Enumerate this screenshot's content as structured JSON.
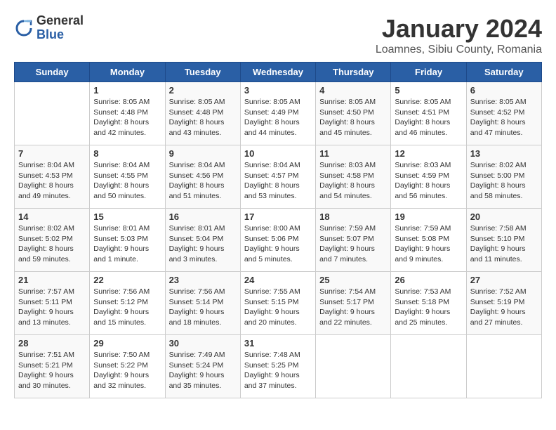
{
  "logo": {
    "general": "General",
    "blue": "Blue"
  },
  "title": "January 2024",
  "subtitle": "Loamnes, Sibiu County, Romania",
  "days": [
    "Sunday",
    "Monday",
    "Tuesday",
    "Wednesday",
    "Thursday",
    "Friday",
    "Saturday"
  ],
  "weeks": [
    [
      {
        "date": "",
        "content": ""
      },
      {
        "date": "1",
        "content": "Sunrise: 8:05 AM\nSunset: 4:48 PM\nDaylight: 8 hours\nand 42 minutes."
      },
      {
        "date": "2",
        "content": "Sunrise: 8:05 AM\nSunset: 4:48 PM\nDaylight: 8 hours\nand 43 minutes."
      },
      {
        "date": "3",
        "content": "Sunrise: 8:05 AM\nSunset: 4:49 PM\nDaylight: 8 hours\nand 44 minutes."
      },
      {
        "date": "4",
        "content": "Sunrise: 8:05 AM\nSunset: 4:50 PM\nDaylight: 8 hours\nand 45 minutes."
      },
      {
        "date": "5",
        "content": "Sunrise: 8:05 AM\nSunset: 4:51 PM\nDaylight: 8 hours\nand 46 minutes."
      },
      {
        "date": "6",
        "content": "Sunrise: 8:05 AM\nSunset: 4:52 PM\nDaylight: 8 hours\nand 47 minutes."
      }
    ],
    [
      {
        "date": "7",
        "content": "Sunrise: 8:04 AM\nSunset: 4:53 PM\nDaylight: 8 hours\nand 49 minutes."
      },
      {
        "date": "8",
        "content": "Sunrise: 8:04 AM\nSunset: 4:55 PM\nDaylight: 8 hours\nand 50 minutes."
      },
      {
        "date": "9",
        "content": "Sunrise: 8:04 AM\nSunset: 4:56 PM\nDaylight: 8 hours\nand 51 minutes."
      },
      {
        "date": "10",
        "content": "Sunrise: 8:04 AM\nSunset: 4:57 PM\nDaylight: 8 hours\nand 53 minutes."
      },
      {
        "date": "11",
        "content": "Sunrise: 8:03 AM\nSunset: 4:58 PM\nDaylight: 8 hours\nand 54 minutes."
      },
      {
        "date": "12",
        "content": "Sunrise: 8:03 AM\nSunset: 4:59 PM\nDaylight: 8 hours\nand 56 minutes."
      },
      {
        "date": "13",
        "content": "Sunrise: 8:02 AM\nSunset: 5:00 PM\nDaylight: 8 hours\nand 58 minutes."
      }
    ],
    [
      {
        "date": "14",
        "content": "Sunrise: 8:02 AM\nSunset: 5:02 PM\nDaylight: 8 hours\nand 59 minutes."
      },
      {
        "date": "15",
        "content": "Sunrise: 8:01 AM\nSunset: 5:03 PM\nDaylight: 9 hours\nand 1 minute."
      },
      {
        "date": "16",
        "content": "Sunrise: 8:01 AM\nSunset: 5:04 PM\nDaylight: 9 hours\nand 3 minutes."
      },
      {
        "date": "17",
        "content": "Sunrise: 8:00 AM\nSunset: 5:06 PM\nDaylight: 9 hours\nand 5 minutes."
      },
      {
        "date": "18",
        "content": "Sunrise: 7:59 AM\nSunset: 5:07 PM\nDaylight: 9 hours\nand 7 minutes."
      },
      {
        "date": "19",
        "content": "Sunrise: 7:59 AM\nSunset: 5:08 PM\nDaylight: 9 hours\nand 9 minutes."
      },
      {
        "date": "20",
        "content": "Sunrise: 7:58 AM\nSunset: 5:10 PM\nDaylight: 9 hours\nand 11 minutes."
      }
    ],
    [
      {
        "date": "21",
        "content": "Sunrise: 7:57 AM\nSunset: 5:11 PM\nDaylight: 9 hours\nand 13 minutes."
      },
      {
        "date": "22",
        "content": "Sunrise: 7:56 AM\nSunset: 5:12 PM\nDaylight: 9 hours\nand 15 minutes."
      },
      {
        "date": "23",
        "content": "Sunrise: 7:56 AM\nSunset: 5:14 PM\nDaylight: 9 hours\nand 18 minutes."
      },
      {
        "date": "24",
        "content": "Sunrise: 7:55 AM\nSunset: 5:15 PM\nDaylight: 9 hours\nand 20 minutes."
      },
      {
        "date": "25",
        "content": "Sunrise: 7:54 AM\nSunset: 5:17 PM\nDaylight: 9 hours\nand 22 minutes."
      },
      {
        "date": "26",
        "content": "Sunrise: 7:53 AM\nSunset: 5:18 PM\nDaylight: 9 hours\nand 25 minutes."
      },
      {
        "date": "27",
        "content": "Sunrise: 7:52 AM\nSunset: 5:19 PM\nDaylight: 9 hours\nand 27 minutes."
      }
    ],
    [
      {
        "date": "28",
        "content": "Sunrise: 7:51 AM\nSunset: 5:21 PM\nDaylight: 9 hours\nand 30 minutes."
      },
      {
        "date": "29",
        "content": "Sunrise: 7:50 AM\nSunset: 5:22 PM\nDaylight: 9 hours\nand 32 minutes."
      },
      {
        "date": "30",
        "content": "Sunrise: 7:49 AM\nSunset: 5:24 PM\nDaylight: 9 hours\nand 35 minutes."
      },
      {
        "date": "31",
        "content": "Sunrise: 7:48 AM\nSunset: 5:25 PM\nDaylight: 9 hours\nand 37 minutes."
      },
      {
        "date": "",
        "content": ""
      },
      {
        "date": "",
        "content": ""
      },
      {
        "date": "",
        "content": ""
      }
    ]
  ]
}
